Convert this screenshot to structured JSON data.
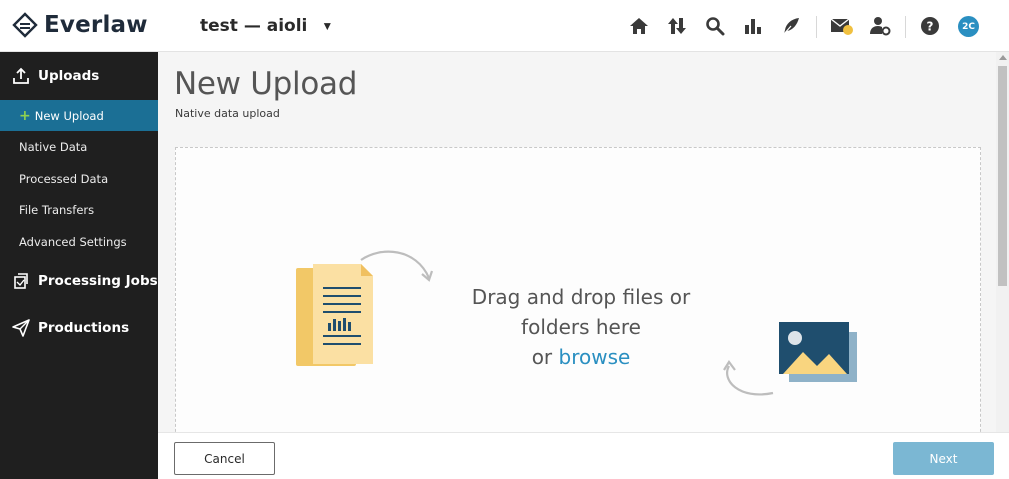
{
  "header": {
    "logo_text": "Everlaw",
    "project_name": "test — aioli",
    "user_initials": "2C",
    "icons": [
      "home-icon",
      "sort-arrows-icon",
      "search-icon",
      "bar-chart-icon",
      "quill-pen-icon",
      "messages-icon",
      "user-settings-icon",
      "help-icon"
    ]
  },
  "sidebar": {
    "uploads_label": "Uploads",
    "items": [
      {
        "label": "New Upload",
        "active": true
      },
      {
        "label": "Native Data"
      },
      {
        "label": "Processed Data"
      },
      {
        "label": "File Transfers"
      },
      {
        "label": "Advanced Settings"
      }
    ],
    "processing_jobs_label": "Processing Jobs",
    "productions_label": "Productions"
  },
  "main": {
    "title": "New Upload",
    "subtitle": "Native data upload",
    "drop_line1": "Drag and drop files or",
    "drop_line2": "folders here",
    "drop_or": "or",
    "browse_label": "browse"
  },
  "footer": {
    "cancel_label": "Cancel",
    "next_label": "Next"
  },
  "colors": {
    "sidebar_bg": "#1f1f1f",
    "active_item": "#1b6f95",
    "accent": "#2a8fc1",
    "next_button": "#7bb7d3",
    "doc_yellow": "#f9d57f"
  }
}
